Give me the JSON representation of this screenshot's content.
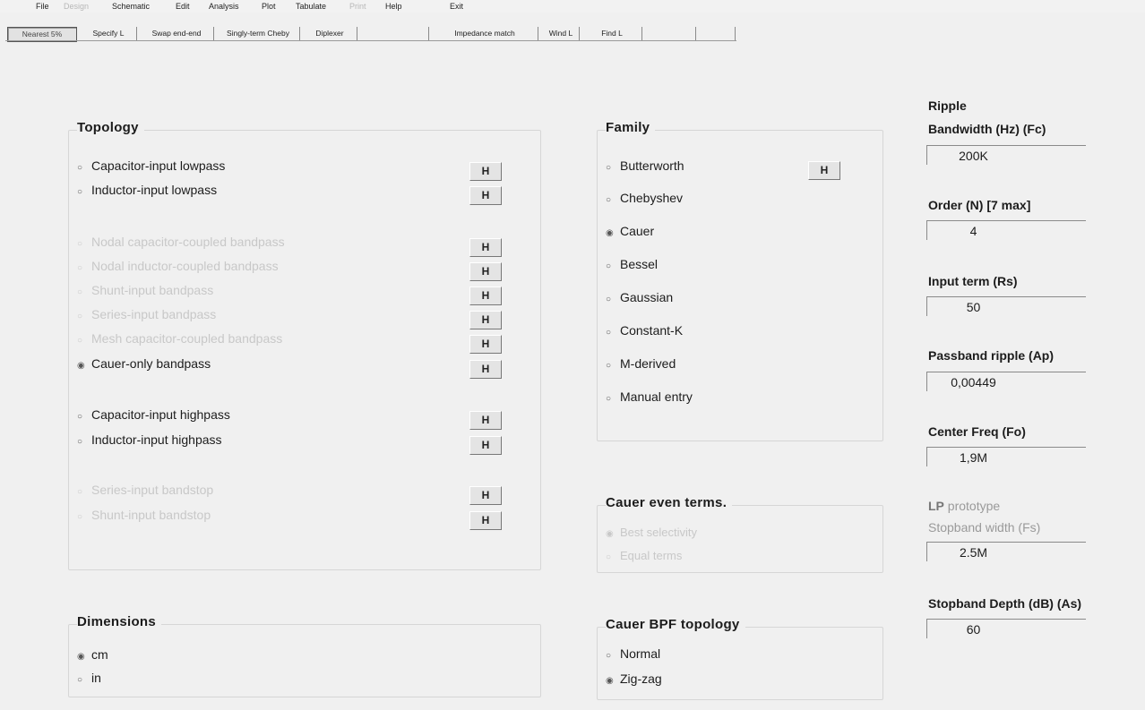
{
  "menu": {
    "items": [
      "File",
      "Design",
      "Schematic",
      "Edit",
      "Analysis",
      "Plot",
      "Tabulate",
      "Print",
      "Help",
      "Exit"
    ]
  },
  "toolbar": {
    "buttons": [
      "Nearest 5%",
      "Specify L",
      "Swap end-end",
      "Singly-term Cheby",
      "Diplexer",
      "Impedance match",
      "Wind L",
      "Find L"
    ]
  },
  "topology": {
    "title": "Topology",
    "options": [
      "Capacitor-input lowpass",
      "Inductor-input lowpass",
      "Nodal capacitor-coupled bandpass",
      "Nodal inductor-coupled bandpass",
      "Shunt-input bandpass",
      "Series-input bandpass",
      "Mesh capacitor-coupled bandpass",
      "Cauer-only bandpass",
      "Capacitor-input highpass",
      "Inductor-input highpass",
      "Series-input bandstop",
      "Shunt-input bandstop"
    ],
    "button_label": "H"
  },
  "family": {
    "title": "Family",
    "options": [
      "Butterworth",
      "Chebyshev",
      "Cauer",
      "Bessel",
      "Gaussian",
      "Constant-K",
      "M-derived",
      "Manual entry"
    ],
    "selected": "Cauer",
    "button_label": "H"
  },
  "cauer_even_terms": {
    "title": "Cauer even terms.",
    "options": [
      "Best selectivity",
      "Equal terms"
    ]
  },
  "cauer_bpf_topology": {
    "title": "Cauer BPF topology",
    "options": [
      "Normal",
      "Zig-zag"
    ],
    "selected": "Zig-zag"
  },
  "dimensions": {
    "title": "Dimensions",
    "options": [
      "cm",
      "in"
    ],
    "selected": "cm"
  },
  "params": {
    "ripple_label": "Ripple",
    "bandwidth_label": "Bandwidth (Hz)  (Fc)",
    "bandwidth_value": "200K",
    "order_label": "Order (N) [7 max]",
    "order_value": "4",
    "input_term_label": "Input term  (Rs)",
    "input_term_value": "50",
    "passband_ripple_label": "Passband ripple (Ap)",
    "passband_ripple_value": "0,00449",
    "center_freq_label": "Center Freq  (Fo)",
    "center_freq_value": "1,9M",
    "lp_prefix": "LP",
    "lp_prototype_label": "prototype",
    "stopband_width_label": "Stopband width  (Fs)",
    "stopband_width_value": "2.5M",
    "stopband_depth_label": "Stopband Depth (dB) (As)",
    "stopband_depth_value": "60"
  }
}
